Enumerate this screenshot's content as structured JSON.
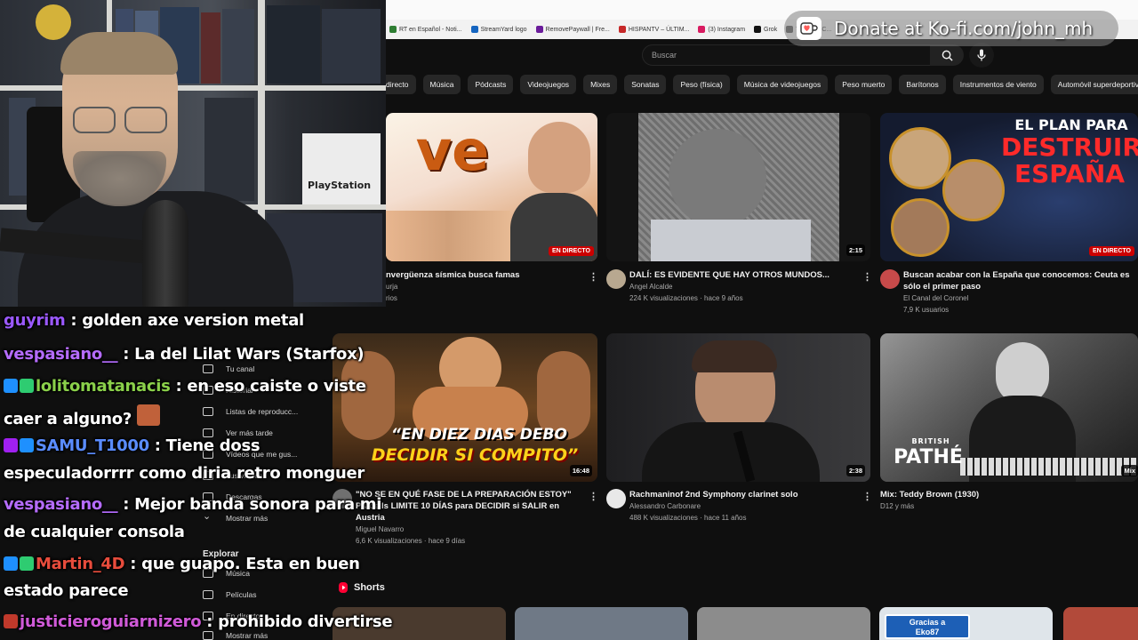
{
  "browser": {
    "bookmarks": [
      {
        "label": "RT en Español - Noti...",
        "color": "#2e7d32"
      },
      {
        "label": "StreamYard logo",
        "color": "#1565c0"
      },
      {
        "label": "RemovePaywall | Fre...",
        "color": "#6a1b9a"
      },
      {
        "label": "HISPANTV – ÚLTIM...",
        "color": "#c62828"
      },
      {
        "label": "(3) Instagram",
        "color": "#d81b60"
      },
      {
        "label": "Grok",
        "color": "#111111"
      },
      {
        "label": "The best C...",
        "color": "#555555"
      }
    ]
  },
  "youtube": {
    "search_placeholder": "Buscar",
    "chips": [
      "directo",
      "Música",
      "Pódcasts",
      "Videojuegos",
      "Mixes",
      "Sonatas",
      "Peso (física)",
      "Música de videojuegos",
      "Peso muerto",
      "Barítonos",
      "Instrumentos de viento",
      "Automóvil superdeportivo"
    ],
    "videos": [
      {
        "title": "nvergüenza sísmica busca famas",
        "channel": "urja",
        "stats": "rios",
        "badge": "EN DIRECTO",
        "thumb_text": "ve"
      },
      {
        "title": "DALÍ: ES EVIDENTE QUE HAY OTROS MUNDOS...",
        "channel": "Angel Alcalde",
        "stats": "224 K visualizaciones · hace 9 años",
        "badge": "2:15"
      },
      {
        "title": "Buscan acabar con la España que conocemos: Ceuta es sólo el primer paso",
        "channel": "El Canal del Coronel",
        "stats": "7,9 K usuarios",
        "badge": "EN DIRECTO",
        "thumb_text_1": "EL PLAN PARA",
        "thumb_text_2": "DESTRUIR",
        "thumb_text_3": "ESPAÑA"
      },
      {
        "title": "\"NO SE EN QUÉ FASE DE LA PREPARACIÓN ESTOY\" Pradells LIMITE 10 DÍAS para DECIDIR si SALIR en Austria",
        "channel": "Miguel Navarro",
        "stats": "6,6 K visualizaciones · hace 9 días",
        "badge": "16:48",
        "thumb_text_1": "“EN DIEZ DIAS DEBO",
        "thumb_text_2": "DECIDIR SI COMPITO”"
      },
      {
        "title": "Rachmaninof 2nd Symphony clarinet solo",
        "channel": "Alessandro Carbonare",
        "stats": "488 K visualizaciones · hace 11 años",
        "badge": "2:38"
      },
      {
        "title": "Mix: Teddy Brown (1930)",
        "channel": "D12 y más",
        "stats": "",
        "badge": "Mix",
        "thumb_text_1": "BRITISH",
        "thumb_text_2": "PATHÉ"
      }
    ],
    "sidebar": {
      "items": [
        "Tu canal",
        "Historial",
        "Listas de reproducc...",
        "Ver más tarde",
        "Vídeos que me gus...",
        "Tus vídeos",
        "Descargas",
        "Mostrar más"
      ],
      "explore_heading": "Explorar",
      "explore_items": [
        "Música",
        "Películas",
        "En directo",
        "Mostrar más"
      ]
    },
    "shorts_label": "Shorts",
    "shorts_sign_text_1": "Gracias a",
    "shorts_sign_text_2": "Eko87"
  },
  "webcam": {
    "box_label": "PlayStation"
  },
  "chat": [
    {
      "user": "guyrim",
      "user_color": "#9b59ff",
      "message": ": golden axe version metal",
      "badges": []
    },
    {
      "user": "vespasiano__",
      "user_color": "#b56cff",
      "message": ": La del Lilat Wars (Starfox)",
      "badges": []
    },
    {
      "user": "lolitomatanacis",
      "user_color": "#8ad04a",
      "message": ": en eso caiste o viste",
      "continuation": "caer a alguno?",
      "badges": [
        "#1e90ff",
        "#2ecc71"
      ]
    },
    {
      "user": "SAMU_T1000",
      "user_color": "#5a8cff",
      "message": ": Tiene doss",
      "continuation": "especuladorrrr como diria retro monguer",
      "badges": [
        "#a020f0",
        "#1e90ff"
      ]
    },
    {
      "user": "vespasiano__",
      "user_color": "#b56cff",
      "message": ": Mejor banda sonora para mi",
      "continuation": "de cualquier consola",
      "badges": []
    },
    {
      "user": "Martin_4D",
      "user_color": "#e74c3c",
      "message": ": que guapo. Esta en buen",
      "continuation": "estado parece",
      "badges": [
        "#1e90ff",
        "#2ecc71"
      ]
    },
    {
      "user": "justicieroguiarnizero",
      "user_color": "#d05ad8",
      "message": ": prohibido divertirse",
      "badges": [
        "#c0392b"
      ]
    }
  ],
  "donate": {
    "label": "Donate at Ko-fi.com/john_mh"
  }
}
